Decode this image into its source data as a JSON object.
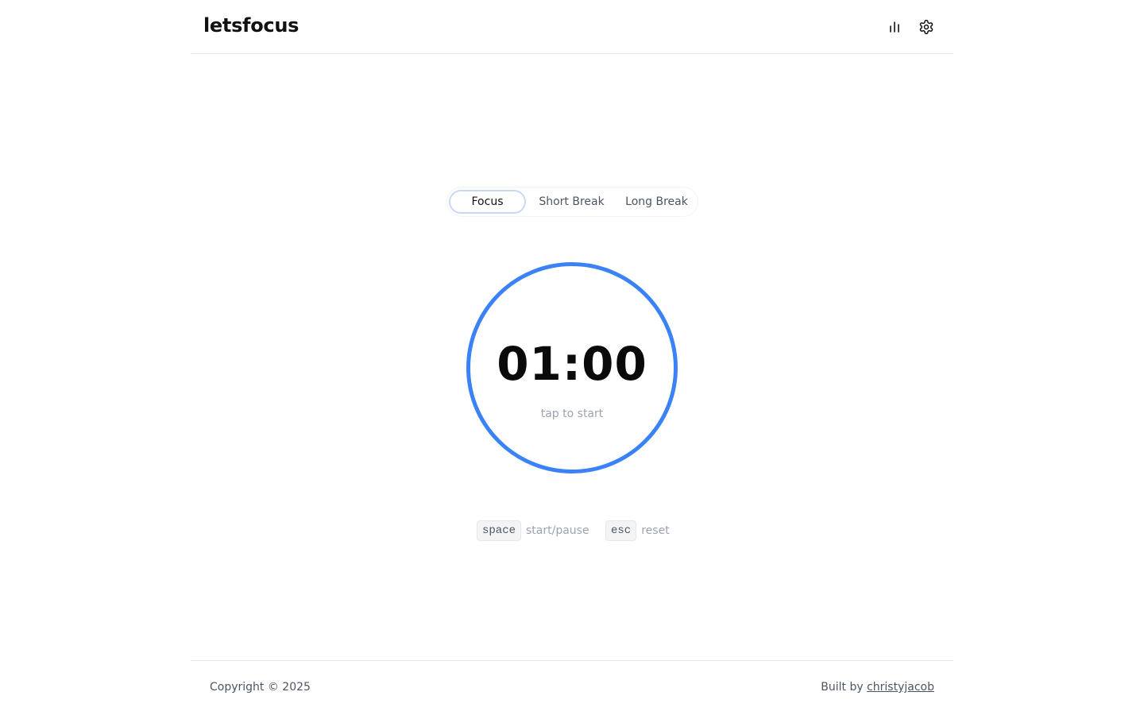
{
  "header": {
    "logo": "letsfocus",
    "stats_icon": "bar-chart-icon",
    "settings_icon": "gear-icon"
  },
  "modes": {
    "tabs": [
      {
        "label": "Focus",
        "active": true
      },
      {
        "label": "Short Break",
        "active": false
      },
      {
        "label": "Long Break",
        "active": false
      }
    ]
  },
  "timer": {
    "time": "01:00",
    "hint": "tap to start",
    "ring_color": "#3b82f6"
  },
  "shortcuts": [
    {
      "key": "space",
      "action": "start/pause"
    },
    {
      "key": "esc",
      "action": "reset"
    }
  ],
  "footer": {
    "copyright": "Copyright © 2025",
    "built_by_prefix": "Built by ",
    "author": "christyjacob"
  }
}
